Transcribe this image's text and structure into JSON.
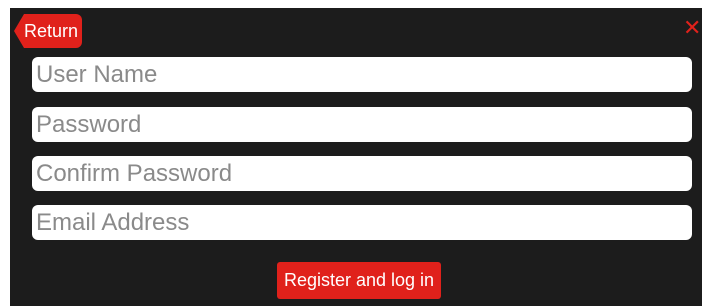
{
  "header": {
    "return_label": "Return",
    "close_glyph": "✕"
  },
  "form": {
    "fields": [
      {
        "name": "username",
        "placeholder": "User Name",
        "value": ""
      },
      {
        "name": "password",
        "placeholder": "Password",
        "value": ""
      },
      {
        "name": "confirm_password",
        "placeholder": "Confirm Password",
        "value": ""
      },
      {
        "name": "email",
        "placeholder": "Email Address",
        "value": ""
      }
    ],
    "submit_label": "Register and log in"
  },
  "colors": {
    "background": "#1c1c1c",
    "accent": "#e0211b",
    "field_background": "#ffffff",
    "placeholder": "#8a8a8a"
  },
  "icons": {
    "close": "close-icon"
  }
}
